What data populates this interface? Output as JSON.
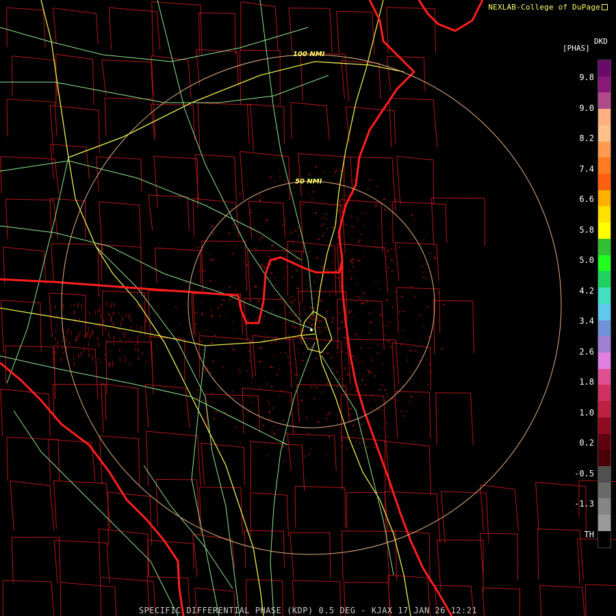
{
  "header": {
    "credit": "NEXLAB-College of DuPage"
  },
  "map": {
    "range_rings": [
      {
        "label": "100 NMI",
        "radius_nmi": 100
      },
      {
        "label": "50 NMI",
        "radius_nmi": 50
      }
    ],
    "colors": {
      "state_borders": "#ff1f1f",
      "county_lines": "#b41818",
      "highways_major": "#f0f04a",
      "highways_minor": "#8fe88f",
      "range_rings": "#e8b080",
      "echo": "#6e0b0b"
    }
  },
  "legend": {
    "product": "DKD",
    "unit": "[PHAS]",
    "ticks": [
      "9.8",
      "9.0",
      "8.2",
      "7.4",
      "6.6",
      "5.8",
      "5.0",
      "4.2",
      "3.4",
      "2.6",
      "1.8",
      "1.0",
      "0.2",
      "-0.5",
      "-1.3",
      "TH"
    ],
    "colors": [
      "#6a0a6a",
      "#8a1a7a",
      "#b04a8a",
      "#ffb080",
      "#ffc08a",
      "#ff9a50",
      "#ff7a20",
      "#ff6010",
      "#ffb000",
      "#ffe000",
      "#ffff00",
      "#30c030",
      "#20ff20",
      "#20d060",
      "#40e0c0",
      "#60c8f0",
      "#7090d8",
      "#a080d0",
      "#e080e0",
      "#e05090",
      "#d03060",
      "#c02040",
      "#900a20",
      "#600010",
      "#4a0008",
      "#505050",
      "#6a6a6a",
      "#858585",
      "#9a9a9a",
      "#000000"
    ]
  },
  "footer": {
    "caption": "SPECIFIC DIFFERENTIAL PHASE (KDP) 0.5 DEG - KJAX 17 JAN 26 12:21"
  }
}
